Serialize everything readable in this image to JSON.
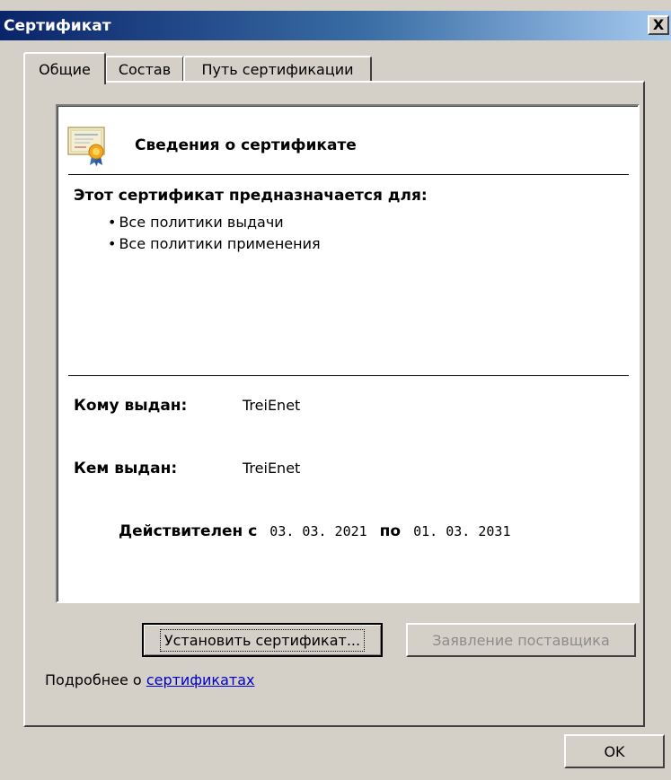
{
  "window": {
    "title": "Сертификат",
    "close_label": "X"
  },
  "tabs": [
    {
      "label": "Общие",
      "active": true
    },
    {
      "label": "Состав",
      "active": false
    },
    {
      "label": "Путь сертификации",
      "active": false
    }
  ],
  "info": {
    "header": "Сведения о сертификате",
    "header_icon": "certificate-icon",
    "purpose_title": "Этот сертификат предназначается для:",
    "purposes": [
      "Все политики выдачи",
      "Все политики применения"
    ],
    "issued_to_label": "Кому выдан:",
    "issued_to_value": "TreiEnet",
    "issued_by_label": "Кем выдан:",
    "issued_by_value": "TreiEnet",
    "valid_from_label": "Действителен с",
    "valid_from": "03. 03. 2021",
    "valid_to_label": "по",
    "valid_to": "01. 03. 2031"
  },
  "buttons": {
    "install": "Установить сертификат...",
    "issuer_statement": "Заявление поставщика",
    "ok": "OK"
  },
  "more_info": {
    "prefix": "Подробнее о ",
    "link": "сертификатах"
  },
  "colors": {
    "dialog_bg": "#d4d0c8",
    "title_bar": "#0a246a",
    "link": "#0000cc"
  }
}
